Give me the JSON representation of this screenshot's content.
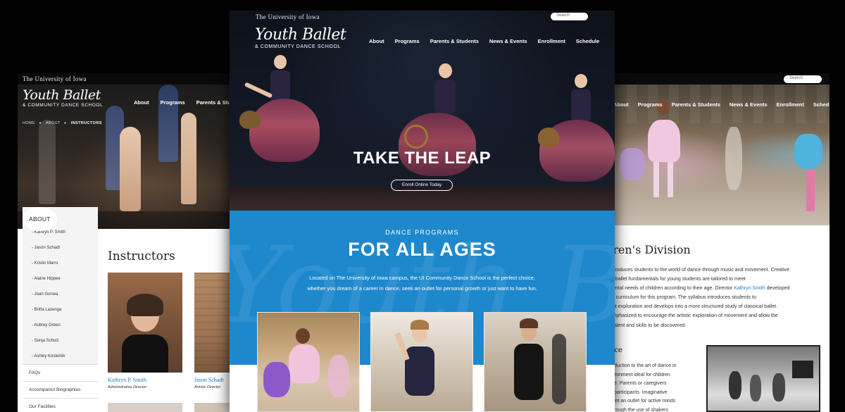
{
  "brand": {
    "university": "The University of Iowa",
    "logo_script": "Youth Ballet",
    "logo_sub": "& COMMUNITY DANCE SCHOOL"
  },
  "center": {
    "search_placeholder": "Search",
    "nav": [
      "About",
      "Programs",
      "Parents & Students",
      "News & Events",
      "Enrollment",
      "Schedule"
    ],
    "hero_tagline": "TAKE THE LEAP",
    "cta": "Enroll Online Today",
    "programs_kicker": "DANCE PROGRAMS",
    "programs_title": "FOR ALL AGES",
    "intro_line1": "Located on The University of Iowa campus, the UI Community Dance School is the perfect choice,",
    "intro_line2": "whether you dream of a career in dance, seek an outlet for personal growth or just want to have fun.",
    "watermark": "Youth Ballet"
  },
  "left": {
    "nav": [
      "About",
      "Programs",
      "Parents & Studen"
    ],
    "breadcrumb": [
      "HOME",
      "ABOUT",
      "INSTRUCTORS"
    ],
    "sidebar_heading": "ABOUT",
    "sidebar_active": "Instructors",
    "sidebar_subitems": [
      "- Kathryn P. Smith",
      "- Jason Schadt",
      "- Kristin Marrs",
      "- Alaine Hippee",
      "- Joan Gonwa",
      "- Britta Lazenga",
      "- Aubrey Green",
      "- Sonja Schulz",
      "- Ashley Kostelnik"
    ],
    "sidebar_sections": [
      "FAQs",
      "Accompanist Biographies",
      "Our Facilities"
    ],
    "page_title": "Instructors",
    "instructors": [
      {
        "name": "Kathryn P. Smith",
        "role": "Administrative Director"
      },
      {
        "name": "Jason Schadt",
        "role": "Artistic Director"
      }
    ]
  },
  "right": {
    "search_placeholder": "Search",
    "nav": [
      "About",
      "Programs",
      "Parents & Students",
      "News & Events",
      "Enrollment",
      "Schedule"
    ],
    "title": "dren's Division",
    "body_lines": [
      "n introduces students to the world of dance through music and movement. Creative",
      "and ballet fundamentals for young students are tailored to meet",
      "omental needs of children according to their age. Director ",
      "sive curriculum for this program. The syllabus introduces students to",
      "ment exploration and develops into a more structured study of classical ballet.",
      "s emphasized to encourage the artistic exploration of movement and allow the",
      "ral talent and skills to be discovered."
    ],
    "director_link": "Kathryn Smith",
    "director_tail": " developed",
    "sub_title": "ance",
    "body2_lines": [
      "ntroduction to the art of dance in",
      "environment ideal for children",
      "three. Parents or caregivers",
      "are participants. Imaginative",
      "resent an outlet for active minds",
      ". Through the use of shakers"
    ]
  },
  "colors": {
    "accent_blue": "#1e88cc",
    "link_blue": "#1a7fc4",
    "nav_bg": "#0a0a0a"
  }
}
